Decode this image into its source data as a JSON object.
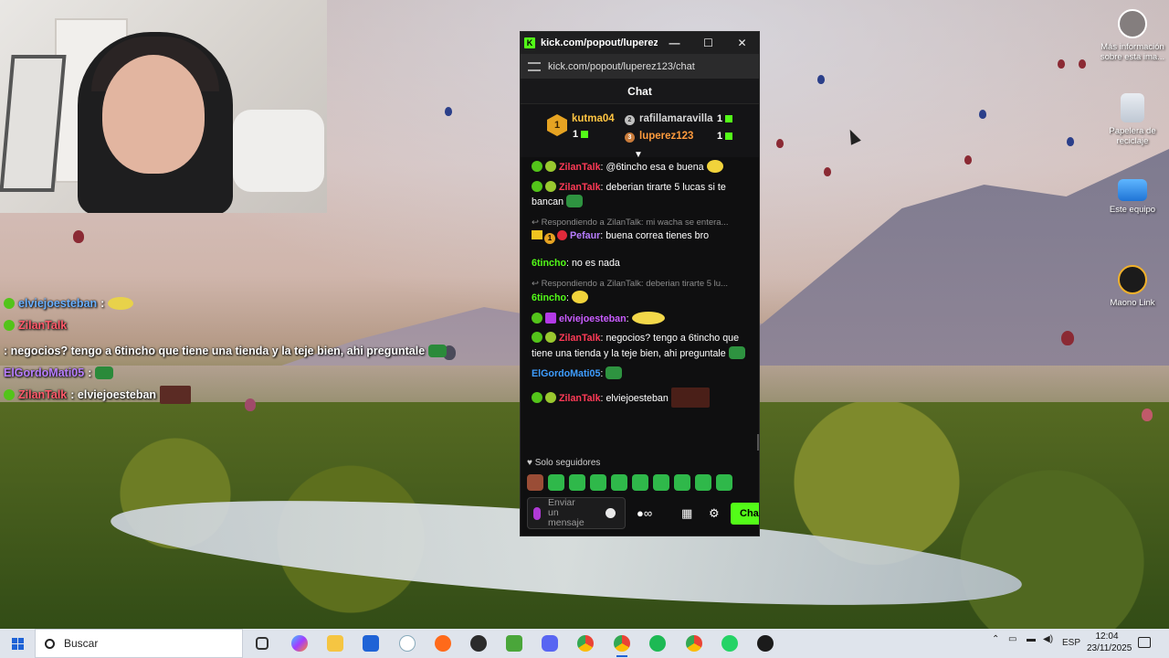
{
  "window": {
    "title": "kick.com/popout/luperez123...",
    "url": "kick.com/popout/luperez123/chat",
    "header": "Chat"
  },
  "leaderboard": {
    "first": {
      "rank": "1",
      "name": "kutma04",
      "count": "1"
    },
    "second": {
      "name": "rafillamaravilla",
      "count": "1"
    },
    "third": {
      "name": "luperez123",
      "count": "1"
    }
  },
  "messages": [
    {
      "user": "ZilanTalk",
      "text": ": @6tincho esa e buena"
    },
    {
      "user": "ZilanTalk",
      "text": ": deberian tirarte 5 lucas si te bancan"
    },
    {
      "reply": "Respondiendo a ZilanTalk: mi wacha se entera...",
      "user": "Pefaur",
      "text": ": buena correa tienes bro"
    },
    {
      "user": "6tincho",
      "text": ": no es nada"
    },
    {
      "reply": "Respondiendo a ZilanTalk: deberian tirarte 5 lu...",
      "user": "6tincho",
      "text": ":"
    },
    {
      "user": "elviejoesteban",
      "text": ":"
    },
    {
      "user": "ZilanTalk",
      "text": ": negocios? tengo a 6tincho que tiene una tienda y la teje bien, ahi preguntale"
    },
    {
      "user": "ElGordoMati05",
      "text": ":"
    },
    {
      "user": "ZilanTalk",
      "text": ": elviejoesteban"
    }
  ],
  "chat_footer": {
    "followers_only": "Solo seguidores",
    "input_placeholder": "Enviar un mensaje",
    "send_label": "Cha"
  },
  "overlay": [
    {
      "user": "elviejoesteban",
      "text": ":"
    },
    {
      "user": "ZilanTalk",
      "text": ": negocios? tengo a 6tincho que tiene una tienda y la teje bien, ahi preguntale"
    },
    {
      "user": "ElGordoMati05",
      "text": ":"
    },
    {
      "user": "ZilanTalk",
      "text": ": elviejoesteban"
    }
  ],
  "desktop_icons": {
    "info": "Más información sobre esta ima...",
    "recycle": "Papelera de reciclaje",
    "pc": "Este equipo",
    "maono": "Maono Link"
  },
  "taskbar": {
    "search": "Buscar",
    "lang": "ESP",
    "time": "12:04",
    "date": "23/11/2025"
  }
}
